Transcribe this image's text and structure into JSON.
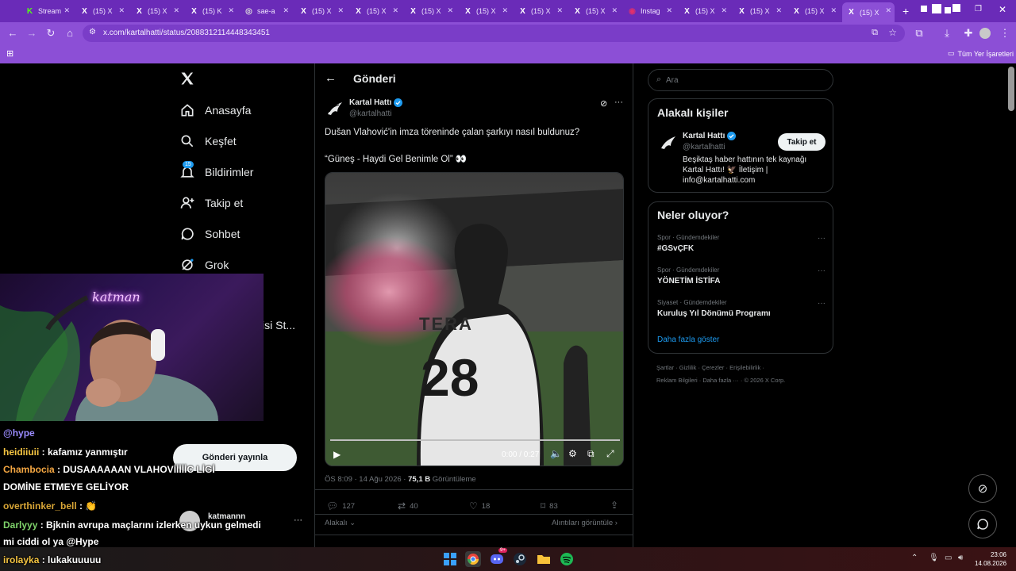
{
  "browser": {
    "tabs": [
      {
        "label": "Stream",
        "icon": "K",
        "color": "#53fc18"
      },
      {
        "label": "(15) X",
        "icon": "X",
        "color": "#ffffff"
      },
      {
        "label": "(15) X",
        "icon": "X",
        "color": "#ffffff"
      },
      {
        "label": "(15) K",
        "icon": "X",
        "color": "#ffffff"
      },
      {
        "label": "sae-a",
        "icon": "◎",
        "color": "#dddddd"
      },
      {
        "label": "(15) X",
        "icon": "X",
        "color": "#ffffff"
      },
      {
        "label": "(15) X",
        "icon": "X",
        "color": "#ffffff"
      },
      {
        "label": "(15) X",
        "icon": "X",
        "color": "#ffffff"
      },
      {
        "label": "(15) X",
        "icon": "X",
        "color": "#ffffff"
      },
      {
        "label": "(15) X",
        "icon": "X",
        "color": "#ffffff"
      },
      {
        "label": "(15) X",
        "icon": "X",
        "color": "#ffffff"
      },
      {
        "label": "Instag",
        "icon": "◉",
        "color": "#e1306c"
      },
      {
        "label": "(15) X",
        "icon": "X",
        "color": "#ffffff"
      },
      {
        "label": "(15) X",
        "icon": "X",
        "color": "#ffffff"
      },
      {
        "label": "(15) X",
        "icon": "X",
        "color": "#ffffff"
      },
      {
        "label": "(15) X",
        "icon": "X",
        "color": "#ffffff",
        "active": true
      }
    ],
    "url": "x.com/kartalhatti/status/2088312114448343451",
    "bookmarks_label": "Tüm Yer İşaretleri"
  },
  "sidebar": {
    "items": [
      {
        "label": "Anasayfa",
        "icon": "home-icon"
      },
      {
        "label": "Keşfet",
        "icon": "search-icon"
      },
      {
        "label": "Bildirimler",
        "icon": "bell-icon",
        "badge": "15"
      },
      {
        "label": "Takip et",
        "icon": "follow-icon"
      },
      {
        "label": "Sohbet",
        "icon": "chat-icon"
      },
      {
        "label": "Grok",
        "icon": "grok-icon"
      }
    ],
    "partial_item": "isi St...",
    "post_button": "Gönderi yayınla",
    "account_name": "katmannn"
  },
  "post": {
    "header_title": "Gönderi",
    "author_name": "Kartal Hattı",
    "author_handle": "@kartalhatti",
    "text_line1": "Dušan Vlahović'in imza töreninde çalan şarkıyı nasıl buldunuz?",
    "text_line2": "“Güneş - Haydi Gel Benimle Ol” 👀",
    "video_time": "0:00 / 0:27",
    "video_jersey_sponsor": "TERA",
    "video_jersey_number": "28",
    "timestamp": "ÖS 8:09 · 14 Ağu 2026 ·",
    "views_count": "75,1 B",
    "views_label": "Görüntüleme",
    "replies": "127",
    "reposts": "40",
    "likes": "18",
    "bookmarks": "83",
    "relevant_label": "Alakalı",
    "quotes_label": "Alıntıları görüntüle"
  },
  "right": {
    "search_placeholder": "Ara",
    "relevant_title": "Alakalı kişiler",
    "person_name": "Kartal Hattı",
    "person_handle": "@kartalhatti",
    "follow_label": "Takip et",
    "person_bio": "Beşiktaş haber hattının tek kaynağı Kartal Hattı! 🦅 İletişim | info@kartalhatti.com",
    "trends_title": "Neler oluyor?",
    "trends": [
      {
        "category": "Spor · Gündemdekiler",
        "title": "#GSvÇFK"
      },
      {
        "category": "Spor · Gündemdekiler",
        "title": "YÖNETİM İSTİFA"
      },
      {
        "category": "Siyaset · Gündemdekiler",
        "title": "Kuruluş Yıl Dönümü Programı"
      }
    ],
    "show_more": "Daha fazla göster",
    "footer_line1": "Şartlar · Gizlilik · Çerezler · Erişilebilirlik ·",
    "footer_line2": "Reklam Bilgileri · Daha fazla ··· · © 2026 X Corp."
  },
  "stream": {
    "neon_sign": "katman",
    "chat": [
      {
        "user": "@hype",
        "user_color": "#9b8cff",
        "message": ""
      },
      {
        "user": "heidiiuii",
        "user_color": "#f5c542",
        "message": " : kafamız yanmıştır"
      },
      {
        "user": "Chambocia",
        "user_color": "#f5a742",
        "message": " : DUSAAAAAAN VLAHOVİİİİİC LİGİ"
      },
      {
        "user": "",
        "user_color": "#ffffff",
        "message": "DOMİNE ETMEYE GELİYOR"
      },
      {
        "user": "overthinker_bell",
        "user_color": "#d9a636",
        "message": " : 👏"
      },
      {
        "user": "Darlyyy",
        "user_color": "#7fd36b",
        "message": " : Bjknin avrupa maçlarını izlerken uykun gelmedi"
      },
      {
        "user": "",
        "user_color": "#ffffff",
        "message": "mi ciddi ol ya @Hype"
      },
      {
        "user": "irolayka",
        "user_color": "#f5c542",
        "message": " : lukakuuuuu"
      }
    ]
  },
  "taskbar": {
    "time": "23:06",
    "date": "14.08.2026",
    "discord_badge": "9+"
  },
  "colors": {
    "x_blue": "#1d9bf0",
    "verified": "#1d9bf0",
    "browser_purple": "#8c4fd6"
  }
}
